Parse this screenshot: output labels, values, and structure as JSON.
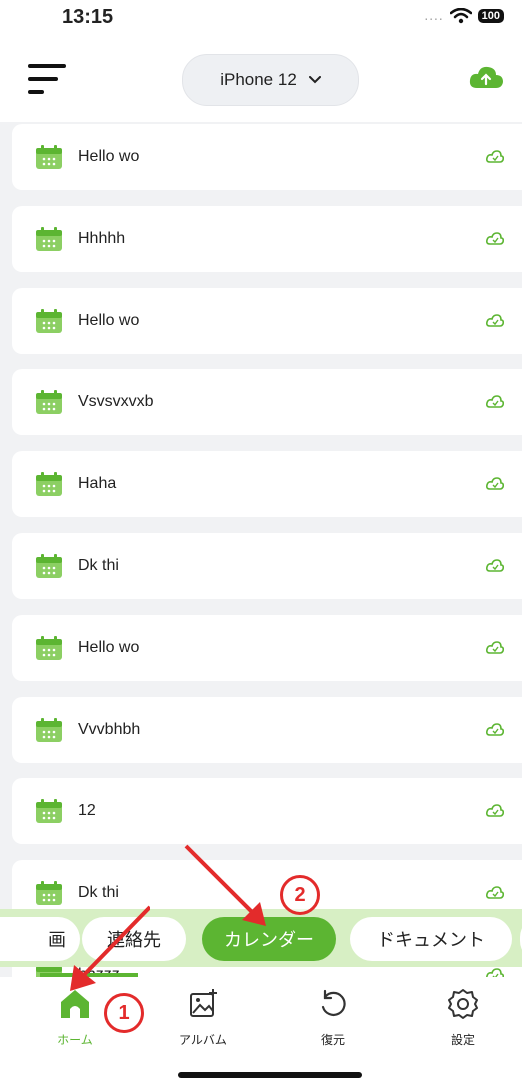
{
  "status_bar": {
    "time": "13:15",
    "signal_dots": "....",
    "battery": "100"
  },
  "header": {
    "device_label": "iPhone 12"
  },
  "list_items": [
    {
      "label": "Hello wo"
    },
    {
      "label": "Hhhhh"
    },
    {
      "label": "Hello wo"
    },
    {
      "label": "Vsvsvxvxb"
    },
    {
      "label": "Haha"
    },
    {
      "label": "Dk thi"
    },
    {
      "label": "Hello wo"
    },
    {
      "label": "Vvvbhbh"
    },
    {
      "label": "12"
    },
    {
      "label": "Dk thi"
    },
    {
      "label": "hhzzz"
    }
  ],
  "tabs": [
    {
      "label": "画"
    },
    {
      "label": "連絡先"
    },
    {
      "label": "カレンダー",
      "active": true
    },
    {
      "label": "ドキュメント"
    }
  ],
  "bottom_nav": [
    {
      "label": "ホーム",
      "icon": "home-icon",
      "active": true
    },
    {
      "label": "アルバム",
      "icon": "album-icon"
    },
    {
      "label": "復元",
      "icon": "restore-icon"
    },
    {
      "label": "設定",
      "icon": "settings-icon"
    }
  ],
  "annotations": {
    "marker_1": "1",
    "marker_2": "2"
  },
  "colors": {
    "accent": "#5cb532",
    "tab_strip_bg": "#d7efc4",
    "annotation_red": "#e32b2b"
  }
}
